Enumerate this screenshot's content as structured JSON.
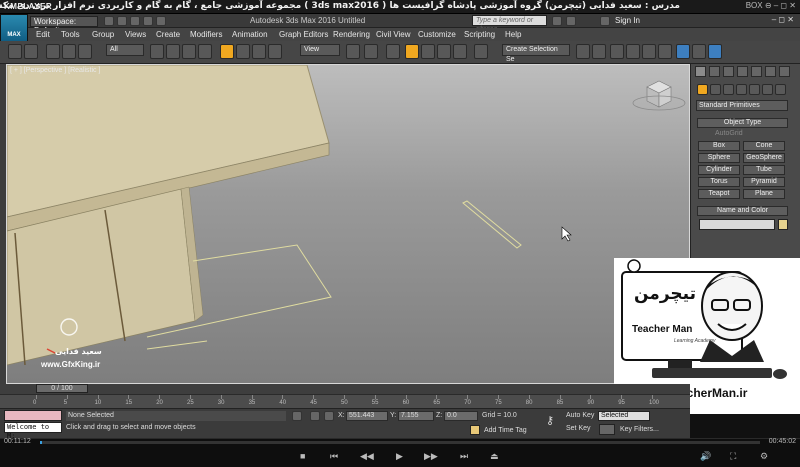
{
  "kmplayer": {
    "logo": "KMPLAYER",
    "title": "مجموعه آموزشی جامع ، گام به گام و کاربردی نرم افزار تری دی مکس 2016 ( 3ds max2016 ) مدرس : سعید فدایی (تیچرمن) گروه آموزشی پادشاه گرافیست ها",
    "controls": "BOX ⊖ ‒ ◻ ✕"
  },
  "max": {
    "logo": "MAX",
    "workspace": "Workspace: Default",
    "app_title": "Autodesk 3ds Max 2016    Untitled",
    "search_placeholder": "Type a keyword or phrase",
    "signin": "Sign In",
    "window_buttons": "‒  ◻  ✕"
  },
  "menu": [
    "Edit",
    "Tools",
    "Group",
    "Views",
    "Create",
    "Modifiers",
    "Animation",
    "Graph Editors",
    "Rendering",
    "Civil View",
    "Customize",
    "Scripting",
    "Help"
  ],
  "toolbar": {
    "filter": "All",
    "ref_coord": "View",
    "selection_set": "Create Selection Se"
  },
  "viewport": {
    "label": "[ + ] [Perspective ] [Realistic ]"
  },
  "watermark": {
    "name": "سعید فدایی",
    "site": "www.GfxKing.ir"
  },
  "command_panel": {
    "dropdown": "Standard Primitives",
    "object_type": "Object Type",
    "autogrid": "AutoGrid",
    "primitives": [
      "Box",
      "Cone",
      "Sphere",
      "GeoSphere",
      "Cylinder",
      "Tube",
      "Torus",
      "Pyramid",
      "Teapot",
      "Plane"
    ],
    "name_color": "Name and Color"
  },
  "ad": {
    "logo_text": "تیچرمن",
    "brand": "Teacher Man",
    "tagline": "Learning Academy",
    "url": "www.TeacherMan.ir"
  },
  "timeline": {
    "frame": "0 / 100",
    "ticks": [
      "0",
      "5",
      "10",
      "15",
      "20",
      "25",
      "30",
      "35",
      "40",
      "45",
      "50",
      "55",
      "60",
      "65",
      "70",
      "75",
      "80",
      "85",
      "90",
      "95",
      "100"
    ]
  },
  "status": {
    "welcome": "Welcome to M:",
    "selection": "None Selected",
    "prompt": "Click and drag to select and move objects",
    "x_label": "X:",
    "x": "551.443",
    "y_label": "Y:",
    "y": "7.155",
    "z_label": "Z:",
    "z": "0.0",
    "grid": "Grid = 10.0",
    "add_time_tag": "Add Time Tag",
    "auto_key": "Auto Key",
    "set_key": "Set Key",
    "selected": "Selected",
    "key_filters": "Key Filters..."
  },
  "player": {
    "current": "00:11:12",
    "total": "00:45:02"
  }
}
